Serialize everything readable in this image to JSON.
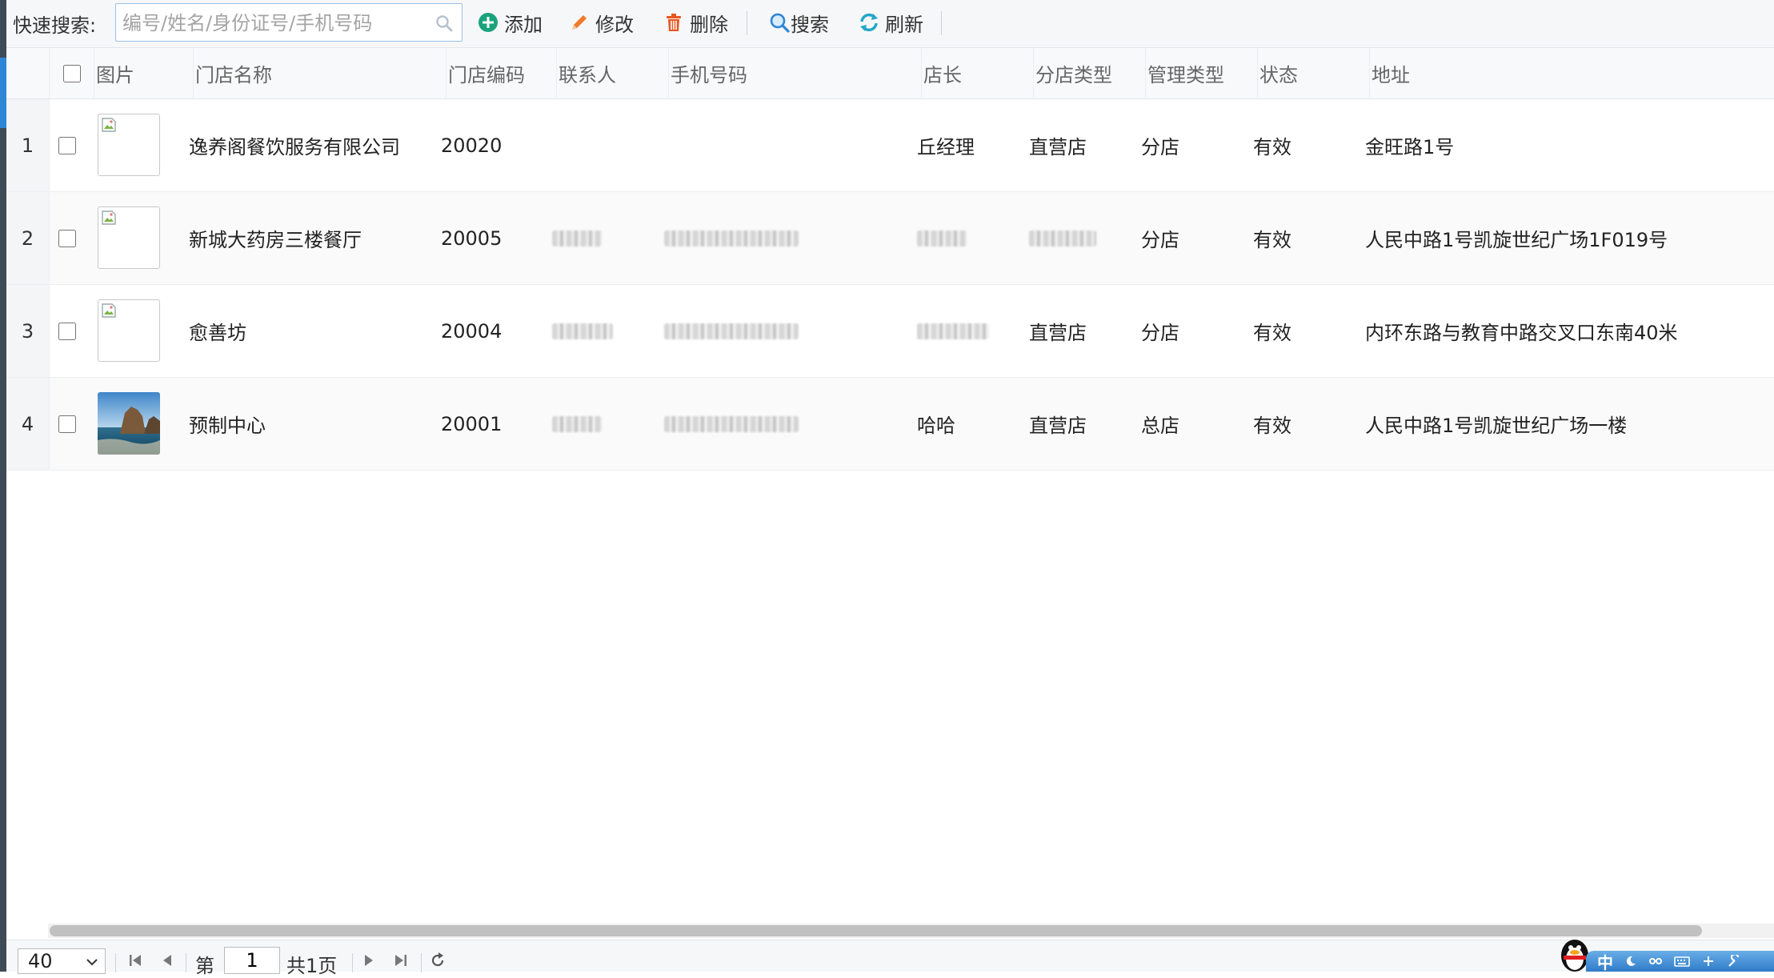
{
  "toolbar": {
    "quick_search_label": "快速搜索:",
    "search_placeholder": "编号/姓名/身份证号/手机号码",
    "add_label": "添加",
    "edit_label": "修改",
    "delete_label": "删除",
    "search_label": "搜索",
    "refresh_label": "刷新"
  },
  "table": {
    "columns": [
      "图片",
      "门店名称",
      "门店编码",
      "联系人",
      "手机号码",
      "店长",
      "分店类型",
      "管理类型",
      "状态",
      "地址"
    ],
    "rows": [
      {
        "num": "1",
        "image": "broken",
        "name": "逸养阁餐饮服务有限公司",
        "code": "20020",
        "contact": "",
        "phone": "",
        "manager": "丘经理",
        "branch_type": "直营店",
        "mgmt_type": "分店",
        "status": "有效",
        "address": "金旺路1号"
      },
      {
        "num": "2",
        "image": "broken",
        "name": "新城大药房三楼餐厅",
        "code": "20005",
        "contact": "[redacted]",
        "phone": "[redacted]",
        "manager": "[redacted]",
        "branch_type": "[redacted]",
        "mgmt_type": "分店",
        "status": "有效",
        "address": "人民中路1号凯旋世纪广场1F019号"
      },
      {
        "num": "3",
        "image": "broken",
        "name": "愈善坊",
        "code": "20004",
        "contact": "[redacted]",
        "phone": "[redacted]",
        "manager": "[redacted]",
        "branch_type": "直营店",
        "mgmt_type": "分店",
        "status": "有效",
        "address": "内环东路与教育中路交叉口东南40米"
      },
      {
        "num": "4",
        "image": "photo",
        "name": "预制中心",
        "code": "20001",
        "contact": "[redacted]",
        "phone": "[redacted]",
        "manager": "哈哈",
        "branch_type": "直营店",
        "mgmt_type": "总店",
        "status": "有效",
        "address": "人民中路1号凯旋世纪广场一楼"
      }
    ]
  },
  "pager": {
    "page_size": "40",
    "page_prefix": "第",
    "page_value": "1",
    "page_suffix": "共1页"
  },
  "ime": {
    "lang": "中"
  },
  "colors": {
    "accent": "#2d86d6",
    "add": "#1aa37a",
    "edit": "#f07a2a",
    "delete": "#e8561f",
    "refresh": "#23a6c8"
  }
}
